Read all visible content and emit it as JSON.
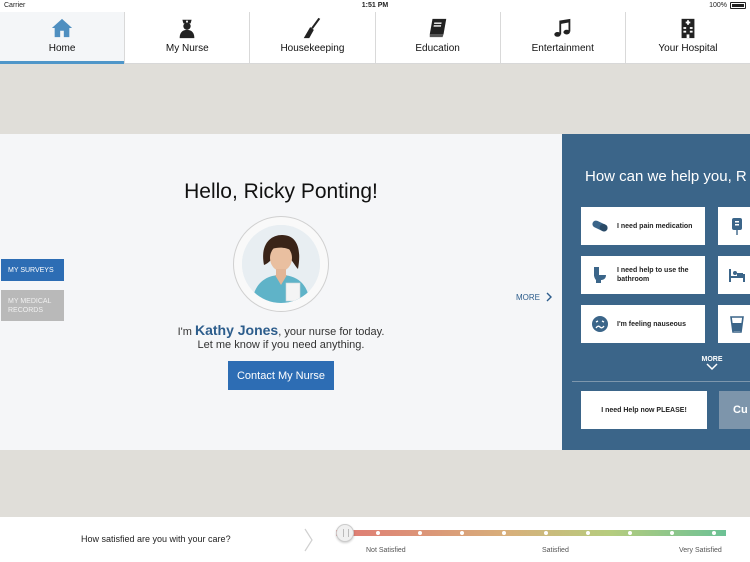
{
  "status_bar": {
    "carrier": "Carrier",
    "time": "1:51 PM",
    "battery": "100%"
  },
  "tabs": [
    {
      "label": "Home",
      "icon": "home-icon",
      "active": true
    },
    {
      "label": "My Nurse",
      "icon": "nurse-icon"
    },
    {
      "label": "Housekeeping",
      "icon": "broom-icon"
    },
    {
      "label": "Education",
      "icon": "book-icon"
    },
    {
      "label": "Entertainment",
      "icon": "music-note-icon"
    },
    {
      "label": "Your Hospital",
      "icon": "hospital-building-icon"
    }
  ],
  "side_buttons": {
    "surveys": "MY SURVEYS",
    "records": "MY MEDICAL RECORDS"
  },
  "greeting": "Hello, Ricky Ponting!",
  "nurse": {
    "prefix": "I'm",
    "name": "Kathy Jones",
    "suffix": ", your nurse for today.",
    "subline": "Let me know if you need anything."
  },
  "contact_button": "Contact My Nurse",
  "more_left": "MORE",
  "help": {
    "title": "How can we help you,  R",
    "requests": [
      {
        "label": "I need pain medication",
        "icon": "pill-icon"
      },
      {
        "label": "",
        "icon": "iv-bag-icon"
      },
      {
        "label": "I need help to use the bathroom",
        "icon": "toilet-icon"
      },
      {
        "label": "",
        "icon": "hospital-bed-icon"
      },
      {
        "label": "I'm feeling nauseous",
        "icon": "nauseous-face-icon"
      },
      {
        "label": "",
        "icon": "water-glass-icon"
      }
    ],
    "more": "MORE",
    "help_now": "I need Help now PLEASE!",
    "cu": "Cu"
  },
  "satisfaction": {
    "question": "How satisfied are you with your care?",
    "labels": [
      "Not Satisfied",
      "Satisfied",
      "Very Satisfied"
    ],
    "level": 0
  },
  "colors": {
    "accent": "#2d6db4",
    "panel": "#3b6589",
    "tab_indicator": "#4f96c9"
  }
}
